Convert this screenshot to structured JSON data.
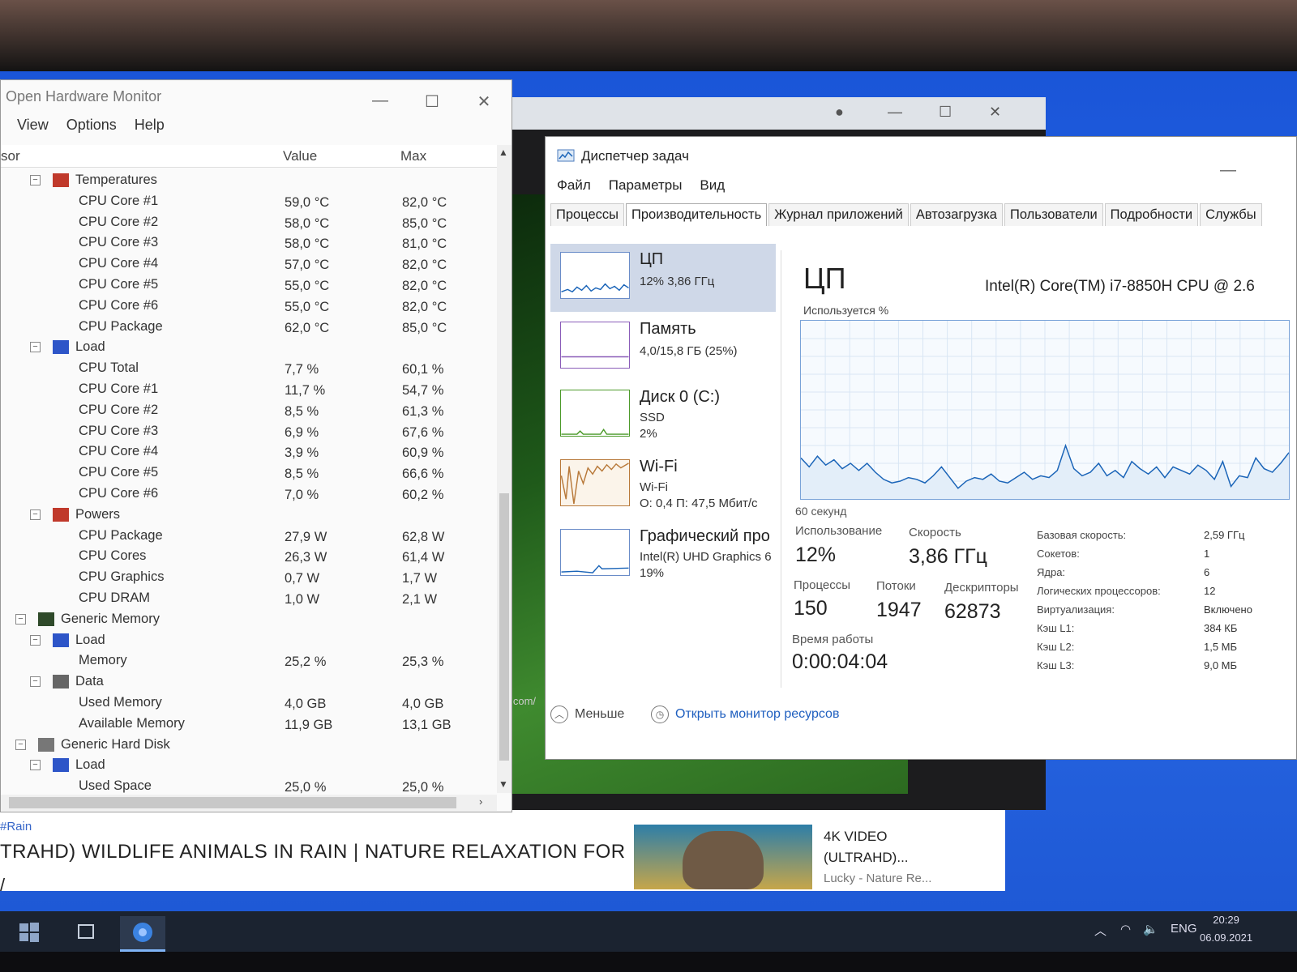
{
  "colors": {
    "desktop": "#2b6be6",
    "cpu_graph": "#1a64b8",
    "selection": "#cfd8e8",
    "link": "#1f5fbf"
  },
  "ohm": {
    "title": "Open Hardware Monitor",
    "menu": [
      "View",
      "Options",
      "Help"
    ],
    "columns": {
      "sensor": "sor",
      "value": "Value",
      "max": "Max"
    },
    "rows": [
      {
        "name": "Temperatures",
        "value": "",
        "max": "",
        "level": 1,
        "toggle": "⊟",
        "icon": "thermometer-icon"
      },
      {
        "name": "CPU Core #1",
        "value": "59,0 °C",
        "max": "82,0 °C",
        "level": 2
      },
      {
        "name": "CPU Core #2",
        "value": "58,0 °C",
        "max": "85,0 °C",
        "level": 2
      },
      {
        "name": "CPU Core #3",
        "value": "58,0 °C",
        "max": "81,0 °C",
        "level": 2
      },
      {
        "name": "CPU Core #4",
        "value": "57,0 °C",
        "max": "82,0 °C",
        "level": 2
      },
      {
        "name": "CPU Core #5",
        "value": "55,0 °C",
        "max": "82,0 °C",
        "level": 2
      },
      {
        "name": "CPU Core #6",
        "value": "55,0 °C",
        "max": "82,0 °C",
        "level": 2
      },
      {
        "name": "CPU Package",
        "value": "62,0 °C",
        "max": "85,0 °C",
        "level": 2
      },
      {
        "name": "Load",
        "value": "",
        "max": "",
        "level": 1,
        "toggle": "⊟",
        "icon": "load-bar-icon"
      },
      {
        "name": "CPU Total",
        "value": "7,7 %",
        "max": "60,1 %",
        "level": 2
      },
      {
        "name": "CPU Core #1",
        "value": "11,7 %",
        "max": "54,7 %",
        "level": 2
      },
      {
        "name": "CPU Core #2",
        "value": "8,5 %",
        "max": "61,3 %",
        "level": 2
      },
      {
        "name": "CPU Core #3",
        "value": "6,9 %",
        "max": "67,6 %",
        "level": 2
      },
      {
        "name": "CPU Core #4",
        "value": "3,9 %",
        "max": "60,9 %",
        "level": 2
      },
      {
        "name": "CPU Core #5",
        "value": "8,5 %",
        "max": "66,6 %",
        "level": 2
      },
      {
        "name": "CPU Core #6",
        "value": "7,0 %",
        "max": "60,2 %",
        "level": 2
      },
      {
        "name": "Powers",
        "value": "",
        "max": "",
        "level": 1,
        "toggle": "⊟",
        "icon": "power-icon"
      },
      {
        "name": "CPU Package",
        "value": "27,9 W",
        "max": "62,8 W",
        "level": 2
      },
      {
        "name": "CPU Cores",
        "value": "26,3 W",
        "max": "61,4 W",
        "level": 2
      },
      {
        "name": "CPU Graphics",
        "value": "0,7 W",
        "max": "1,7 W",
        "level": 2
      },
      {
        "name": "CPU DRAM",
        "value": "1,0 W",
        "max": "2,1 W",
        "level": 2
      },
      {
        "name": "Generic Memory",
        "value": "",
        "max": "",
        "level": 0,
        "toggle": "⊟",
        "icon": "memory-chip-icon"
      },
      {
        "name": "Load",
        "value": "",
        "max": "",
        "level": 1,
        "toggle": "⊟",
        "icon": "load-bar-icon"
      },
      {
        "name": "Memory",
        "value": "25,2 %",
        "max": "25,3 %",
        "level": 2
      },
      {
        "name": "Data",
        "value": "",
        "max": "",
        "level": 1,
        "toggle": "⊟",
        "icon": "data-icon"
      },
      {
        "name": "Used Memory",
        "value": "4,0 GB",
        "max": "4,0 GB",
        "level": 2
      },
      {
        "name": "Available Memory",
        "value": "11,9 GB",
        "max": "13,1 GB",
        "level": 2
      },
      {
        "name": "Generic Hard Disk",
        "value": "",
        "max": "",
        "level": 0,
        "toggle": "⊟",
        "icon": "hard-disk-icon"
      },
      {
        "name": "Load",
        "value": "",
        "max": "",
        "level": 1,
        "toggle": "⊟",
        "icon": "load-bar-icon"
      },
      {
        "name": "Used Space",
        "value": "25,0 %",
        "max": "25,0 %",
        "level": 2
      }
    ]
  },
  "taskmgr": {
    "title": "Диспетчер задач",
    "menu": [
      "Файл",
      "Параметры",
      "Вид"
    ],
    "tabs": [
      "Процессы",
      "Производительность",
      "Журнал приложений",
      "Автозагрузка",
      "Пользователи",
      "Подробности",
      "Службы"
    ],
    "selected_tab": 1,
    "sidebar": [
      {
        "name": "ЦП",
        "lines": [
          "12% 3,86 ГГц"
        ]
      },
      {
        "name": "Память",
        "lines": [
          "4,0/15,8 ГБ (25%)"
        ]
      },
      {
        "name": "Диск 0 (C:)",
        "lines": [
          "SSD",
          "2%"
        ]
      },
      {
        "name": "Wi-Fi",
        "lines": [
          "Wi-Fi",
          "О: 0,4 П: 47,5 Мбит/с"
        ]
      },
      {
        "name": "Графический про",
        "lines": [
          "Intel(R) UHD Graphics 6",
          "19%"
        ]
      }
    ],
    "cpu": {
      "heading": "ЦП",
      "model": "Intel(R) Core(TM) i7-8850H CPU @ 2.6",
      "graph_label": "Используется %",
      "graph_time": "60 секунд",
      "usage_history": [
        23,
        18,
        24,
        19,
        22,
        17,
        20,
        16,
        20,
        15,
        11,
        9,
        10,
        12,
        11,
        9,
        13,
        18,
        12,
        6,
        10,
        12,
        11,
        14,
        10,
        9,
        12,
        15,
        11,
        13,
        12,
        16,
        30,
        17,
        13,
        15,
        20,
        13,
        16,
        12,
        21,
        17,
        14,
        18,
        12,
        18,
        16,
        14,
        19,
        16,
        11,
        21,
        7,
        13,
        12,
        23,
        17,
        15,
        20,
        26
      ],
      "ylim": [
        0,
        100
      ],
      "stats": {
        "usage_label": "Использование",
        "usage": "12%",
        "speed_label": "Скорость",
        "speed": "3,86 ГГц",
        "processes_label": "Процессы",
        "processes": "150",
        "threads_label": "Потоки",
        "threads": "1947",
        "handles_label": "Дескрипторы",
        "handles": "62873",
        "uptime_label": "Время работы",
        "uptime": "0:00:04:04"
      },
      "specs": [
        {
          "label": "Базовая скорость:",
          "value": "2,59 ГГц"
        },
        {
          "label": "Сокетов:",
          "value": "1"
        },
        {
          "label": "Ядра:",
          "value": "6"
        },
        {
          "label": "Логических процессоров:",
          "value": "12"
        },
        {
          "label": "Виртуализация:",
          "value": "Включено"
        },
        {
          "label": "Кэш L1:",
          "value": "384 КБ"
        },
        {
          "label": "Кэш L2:",
          "value": "1,5 МБ"
        },
        {
          "label": "Кэш L3:",
          "value": "9,0 МБ"
        }
      ]
    },
    "footer": {
      "less": "Меньше",
      "open_monitor": "Открыть монитор ресурсов"
    }
  },
  "youtube": {
    "tag": "#Rain",
    "title": "TRAHD) WILDLIFE ANIMALS IN RAIN | NATURE RELAXATION FOR",
    "title_tail": "/",
    "url_fragment": "g.com/",
    "side_title_1": "4K VIDEO",
    "side_title_2": "(ULTRAHD)...",
    "side_channel": "Lucky - Nature Re..."
  },
  "taskbar": {
    "lang": "ENG",
    "time": "20:29",
    "date": "06.09.2021"
  }
}
